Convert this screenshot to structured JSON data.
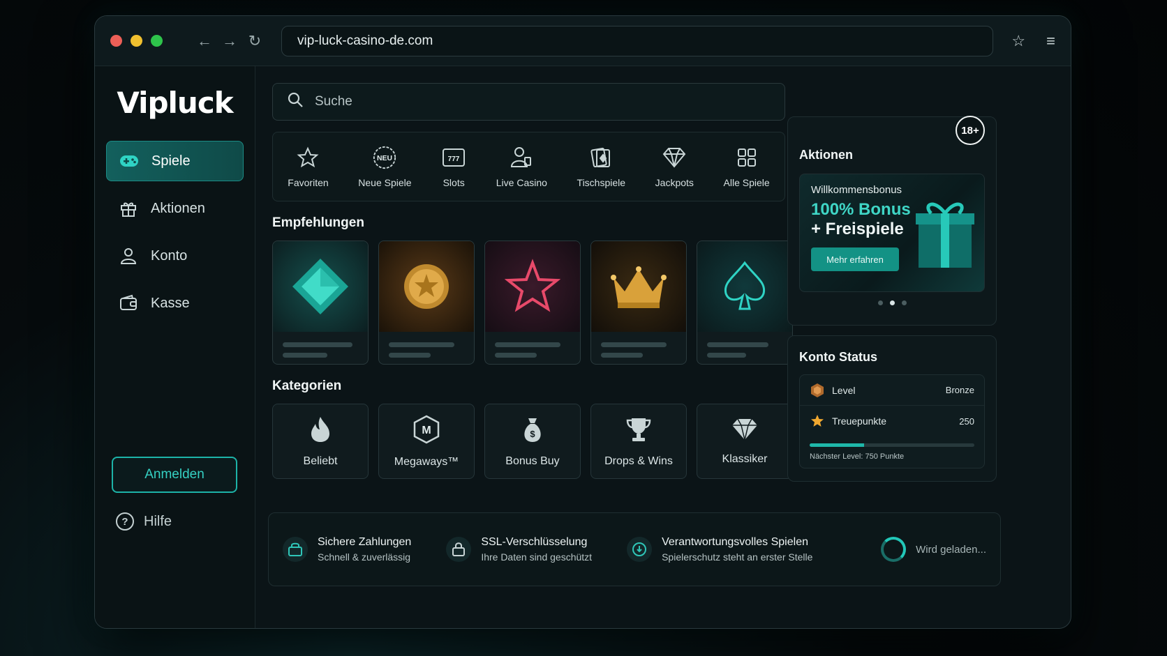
{
  "browser": {
    "url": "vip-luck-casino-de.com"
  },
  "sidebar": {
    "logo": "Vipluck",
    "items": [
      {
        "label": "Spiele",
        "icon": "gamepad-icon",
        "active": true
      },
      {
        "label": "Aktionen",
        "icon": "gift-icon",
        "active": false
      },
      {
        "label": "Konto",
        "icon": "user-icon",
        "active": false
      },
      {
        "label": "Kasse",
        "icon": "wallet-icon",
        "active": false
      }
    ],
    "login_label": "Anmelden",
    "help_label": "Hilfe"
  },
  "search": {
    "placeholder": "Suche"
  },
  "categories_bar": [
    {
      "label": "Favoriten",
      "icon": "star-icon"
    },
    {
      "label": "Neue Spiele",
      "icon": "neu-badge-icon",
      "badge": "NEU"
    },
    {
      "label": "Slots",
      "icon": "slot-machine-icon",
      "badge": "777"
    },
    {
      "label": "Live Casino",
      "icon": "dealer-icon"
    },
    {
      "label": "Tischspiele",
      "icon": "cards-icon"
    },
    {
      "label": "Jackpots",
      "icon": "diamond-icon"
    },
    {
      "label": "Alle Spiele",
      "icon": "grid-icon"
    }
  ],
  "recommendations": {
    "title": "Empfehlungen",
    "cards": [
      {
        "art": "teal-gem-art"
      },
      {
        "art": "gold-coin-art"
      },
      {
        "art": "red-star-art"
      },
      {
        "art": "gold-crown-art"
      },
      {
        "art": "spade-art"
      }
    ]
  },
  "categories": {
    "title": "Kategorien",
    "cards": [
      {
        "label": "Beliebt",
        "icon": "flame-icon"
      },
      {
        "label": "Megaways™",
        "icon": "megaways-icon",
        "badge": "M"
      },
      {
        "label": "Bonus Buy",
        "icon": "money-bag-icon"
      },
      {
        "label": "Drops & Wins",
        "icon": "trophy-icon"
      },
      {
        "label": "Klassiker",
        "icon": "diamond-icon"
      }
    ]
  },
  "promotions": {
    "age_badge": "18+",
    "title": "Aktionen",
    "card": {
      "small": "Willkommensbonus",
      "big": "100% Bonus",
      "big2": "+ Freispiele",
      "button": "Mehr erfahren"
    },
    "slides": 3,
    "active_slide": 2
  },
  "account_status": {
    "title": "Konto Status",
    "level_label": "Level",
    "level_value": "Bronze",
    "points_label": "Treuepunkte",
    "points_value": "250",
    "progress_fraction": 0.33,
    "next_level": "Nächster Level: 750 Punkte"
  },
  "footer": {
    "features": [
      {
        "title": "Sichere Zahlungen",
        "sub": "Schnell & zuverlässig",
        "icon": "secure-payment-icon"
      },
      {
        "title": "SSL-Verschlüsselung",
        "sub": "Ihre Daten sind geschützt",
        "icon": "lock-icon"
      },
      {
        "title": "Verantwortungsvolles Spielen",
        "sub": "Spielerschutz steht an erster Stelle",
        "icon": "shield-icon"
      }
    ],
    "loading": "Wird geladen..."
  },
  "colors": {
    "accent": "#1fb8aa",
    "background": "#0b1417"
  }
}
